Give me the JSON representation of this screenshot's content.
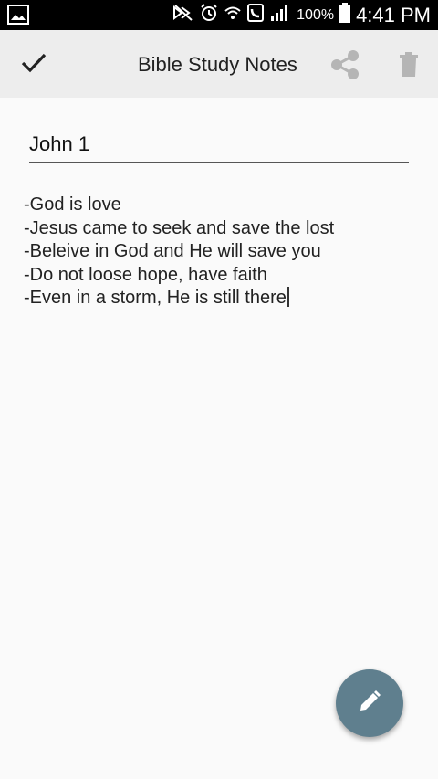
{
  "status_bar": {
    "battery": "100%",
    "time": "4:41 PM",
    "icons": [
      "image-icon",
      "mute-icon",
      "alarm-icon",
      "wifi-icon",
      "call-icon",
      "signal-icon",
      "battery-icon"
    ]
  },
  "toolbar": {
    "title": "Bible Study Notes",
    "icons": [
      "check-icon",
      "share-icon",
      "trash-icon"
    ]
  },
  "note": {
    "title": "John 1",
    "lines": [
      "-God is love",
      "-Jesus came to seek and save the lost",
      "-Beleive in God and He will save you",
      "-Do not loose hope, have faith",
      "-Even in a storm, He is still there"
    ]
  },
  "fab": {
    "icon": "pencil-icon"
  },
  "colors": {
    "status_bar": "#000000",
    "app_bar": "#ededed",
    "background": "#fafafa",
    "fab": "#5f7f8e"
  }
}
